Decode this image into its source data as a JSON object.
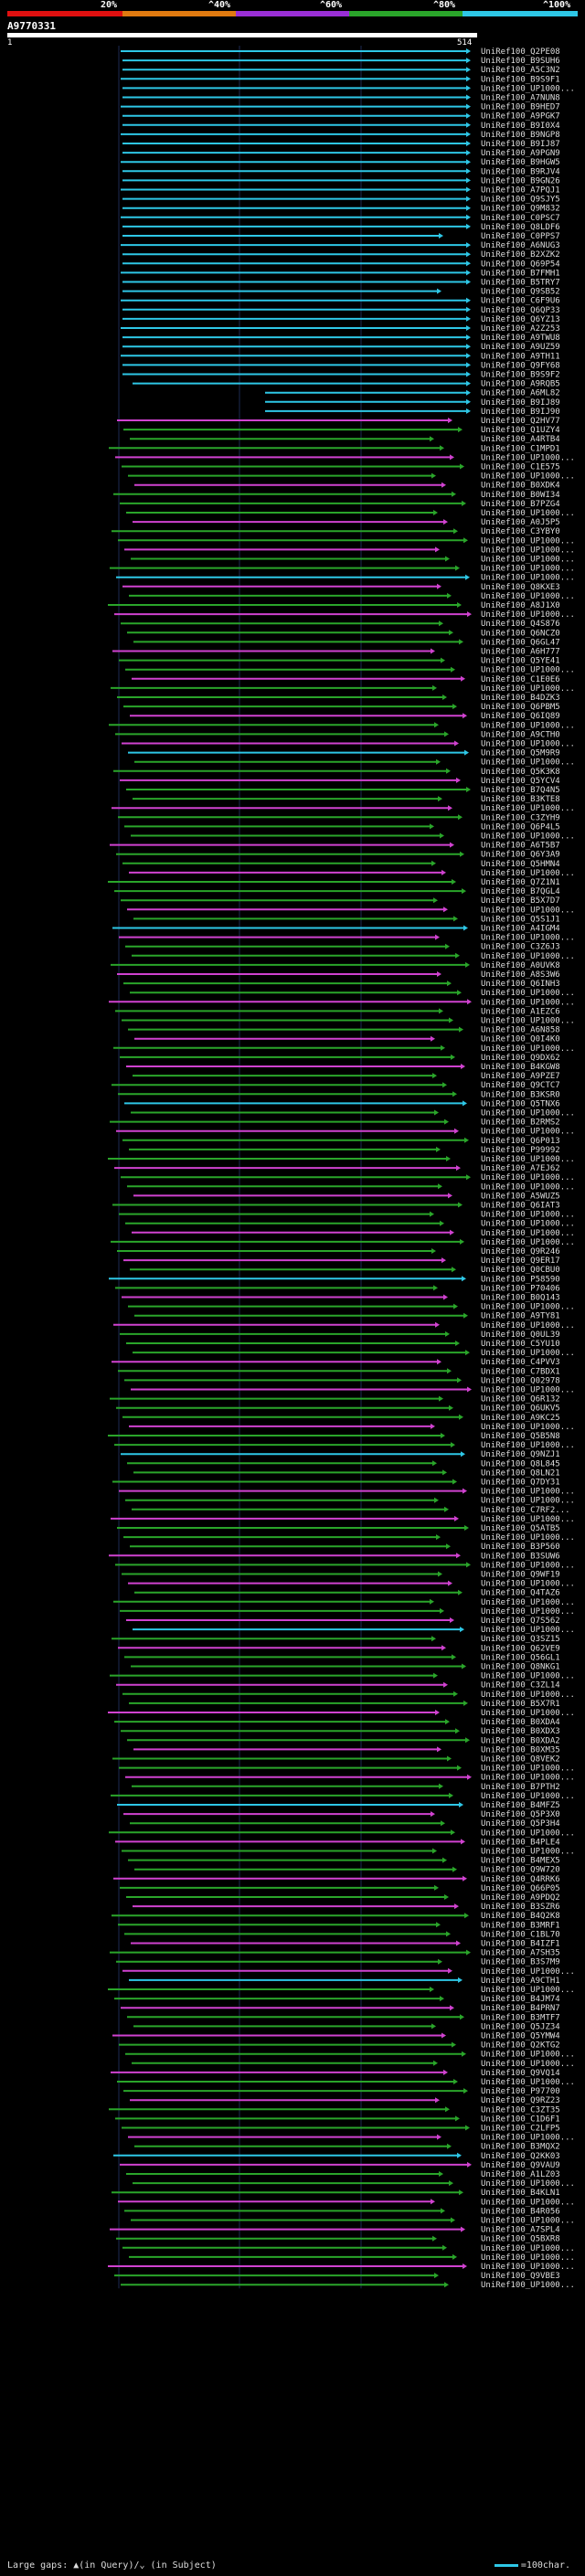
{
  "legend": {
    "ticks": [
      "20%",
      "^40%",
      "^60%",
      "^80%",
      "^100%"
    ],
    "colors": [
      "#e01010",
      "#e07a10",
      "#9a2fd6",
      "#2aa52a",
      "#2ec7e6"
    ]
  },
  "query": {
    "id": "A9770331",
    "start": "1",
    "end": "514"
  },
  "footer": {
    "text": "Large gaps: ▲(in Query)/⌄ (in Subject)",
    "scale": "=100char."
  },
  "hits": [
    "UniRef100_Q2PE08",
    "UniRef100_B9SUH6",
    "UniRef100_A5C3N2",
    "UniRef100_B9S9F1",
    "UniRef100_UP1000...",
    "UniRef100_A7NUN8",
    "UniRef100_B9HED7",
    "UniRef100_A9PGK7",
    "UniRef100_B9I0X4",
    "UniRef100_B9NGP8",
    "UniRef100_B9IJ87",
    "UniRef100_A9PGN9",
    "UniRef100_B9HGW5",
    "UniRef100_B9RJV4",
    "UniRef100_B9GN26",
    "UniRef100_A7PQJ1",
    "UniRef100_Q9SJY5",
    "UniRef100_Q9M832",
    "UniRef100_C0PSC7",
    "UniRef100_Q8LDF6",
    "UniRef100_C0PPS7",
    "UniRef100_A6NUG3",
    "UniRef100_B2XZK2",
    "UniRef100_Q69P54",
    "UniRef100_B7FMH1",
    "UniRef100_B5TRY7",
    "UniRef100_Q9SB52",
    "UniRef100_C6F9U6",
    "UniRef100_Q6QP33",
    "UniRef100_Q6YZ13",
    "UniRef100_A2Z253",
    "UniRef100_A9TWU8",
    "UniRef100_A9UZ59",
    "UniRef100_A9TH11",
    "UniRef100_Q9FY68",
    "UniRef100_B9S9F2",
    "UniRef100_A9RQB5",
    "UniRef100_A6ML82",
    "UniRef100_B9IJ89",
    "UniRef100_B9IJ90",
    "UniRef100_Q2HV77",
    "UniRef100_Q1UZY4",
    "UniRef100_A4RTB4",
    "UniRef100_C1MPD1",
    "UniRef100_UP1000...",
    "UniRef100_C1E575",
    "UniRef100_UP1000...",
    "UniRef100_B0XDK4",
    "UniRef100_B0WI34",
    "UniRef100_B7PZG4",
    "UniRef100_UP1000...",
    "UniRef100_A0J5P5",
    "UniRef100_C3YBY0",
    "UniRef100_UP1000...",
    "UniRef100_UP1000...",
    "UniRef100_UP1000...",
    "UniRef100_UP1000...",
    "UniRef100_UP1000...",
    "UniRef100_Q8KXE3",
    "UniRef100_UP1000...",
    "UniRef100_A8J1X0",
    "UniRef100_UP1000...",
    "UniRef100_Q4S876",
    "UniRef100_Q6NCZ0",
    "UniRef100_Q6GL47",
    "UniRef100_A6H777",
    "UniRef100_Q5YE41",
    "UniRef100_UP1000...",
    "UniRef100_C1E0E6",
    "UniRef100_UP1000...",
    "UniRef100_B4DZK3",
    "UniRef100_Q6PBM5",
    "UniRef100_Q6IQ89",
    "UniRef100_UP1000...",
    "UniRef100_A9CTH0",
    "UniRef100_UP1000...",
    "UniRef100_Q5M9R9",
    "UniRef100_UP1000...",
    "UniRef100_Q5K3K8",
    "UniRef100_Q5YCV4",
    "UniRef100_B7Q4N5",
    "UniRef100_B3KTE8",
    "UniRef100_UP1000...",
    "UniRef100_C3ZYH9",
    "UniRef100_Q6P4L5",
    "UniRef100_UP1000...",
    "UniRef100_A6T5B7",
    "UniRef100_Q6Y3A9",
    "UniRef100_Q5HMN4",
    "UniRef100_UP1000...",
    "UniRef100_Q7Z1N1",
    "UniRef100_B7QGL4",
    "UniRef100_B5X7D7",
    "UniRef100_UP1000...",
    "UniRef100_Q5S1J1",
    "UniRef100_A4IGM4",
    "UniRef100_UP1000...",
    "UniRef100_C3Z6J3",
    "UniRef100_UP1000...",
    "UniRef100_A0UVK8",
    "UniRef100_A8S3W6",
    "UniRef100_Q6INH3",
    "UniRef100_UP1000...",
    "UniRef100_UP1000...",
    "UniRef100_A1EZC6",
    "UniRef100_UP1000...",
    "UniRef100_A6N858",
    "UniRef100_Q0I4K0",
    "UniRef100_UP1000...",
    "UniRef100_Q9DX62",
    "UniRef100_B4KGW8",
    "UniRef100_A9PZE7",
    "UniRef100_Q9CTC7",
    "UniRef100_B3KSR0",
    "UniRef100_Q5TNX6",
    "UniRef100_UP1000...",
    "UniRef100_B2RMS2",
    "UniRef100_UP1000...",
    "UniRef100_Q6P013",
    "UniRef100_P99992",
    "UniRef100_UP1000...",
    "UniRef100_A7EJ62",
    "UniRef100_UP1000...",
    "UniRef100_UP1000...",
    "UniRef100_A5WUZ5",
    "UniRef100_Q6IAT3",
    "UniRef100_UP1000...",
    "UniRef100_UP1000...",
    "UniRef100_UP1000...",
    "UniRef100_UP1000...",
    "UniRef100_Q9R246",
    "UniRef100_Q9ER17",
    "UniRef100_Q0CBU0",
    "UniRef100_P58590",
    "UniRef100_P70406",
    "UniRef100_B0Q143",
    "UniRef100_UP1000...",
    "UniRef100_A9TY81",
    "UniRef100_UP1000...",
    "UniRef100_Q0UL39",
    "UniRef100_C5YU10",
    "UniRef100_UP1000...",
    "UniRef100_C4PVV3",
    "UniRef100_C7BDX1",
    "UniRef100_Q02978",
    "UniRef100_UP1000...",
    "UniRef100_Q6R132",
    "UniRef100_Q6UKV5",
    "UniRef100_A9KC25",
    "UniRef100_UP1000...",
    "UniRef100_Q5B5N8",
    "UniRef100_UP1000...",
    "UniRef100_Q9NZJ1",
    "UniRef100_Q8L845",
    "UniRef100_Q8LN21",
    "UniRef100_Q7DY31",
    "UniRef100_UP1000...",
    "UniRef100_UP1000...",
    "UniRef100_C7RF2...",
    "UniRef100_UP1000...",
    "UniRef100_Q5ATB5",
    "UniRef100_UP1000...",
    "UniRef100_B3P560",
    "UniRef100_B3SUW6",
    "UniRef100_UP1000...",
    "UniRef100_Q9WF19",
    "UniRef100_UP1000...",
    "UniRef100_Q4TAZ6",
    "UniRef100_UP1000...",
    "UniRef100_UP1000...",
    "UniRef100_Q7S562",
    "UniRef100_UP1000...",
    "UniRef100_Q3SZ15",
    "UniRef100_Q62VE9",
    "UniRef100_Q56GL1",
    "UniRef100_Q8NKG1",
    "UniRef100_UP1000...",
    "UniRef100_C3ZL14",
    "UniRef100_UP1000...",
    "UniRef100_B5X7R1",
    "UniRef100_UP1000...",
    "UniRef100_B0XDA4",
    "UniRef100_B0XDX3",
    "UniRef100_B0XDA2",
    "UniRef100_B0XM35",
    "UniRef100_Q8VEK2",
    "UniRef100_UP1000...",
    "UniRef100_UP1000...",
    "UniRef100_B7PTH2",
    "UniRef100_UP1000...",
    "UniRef100_B4MFZ5",
    "UniRef100_Q5P3X0",
    "UniRef100_Q5P3H4",
    "UniRef100_UP1000...",
    "UniRef100_B4PLE4",
    "UniRef100_UP1000...",
    "UniRef100_B4MEX5",
    "UniRef100_Q9W720",
    "UniRef100_Q4RRK6",
    "UniRef100_Q66P05",
    "UniRef100_A9PDQ2",
    "UniRef100_B3SZR6",
    "UniRef100_B4Q2K8",
    "UniRef100_B3MRF1",
    "UniRef100_C1BL70",
    "UniRef100_B4IZF1",
    "UniRef100_A7SH35",
    "UniRef100_B3S7M9",
    "UniRef100_UP1000...",
    "UniRef100_A9CTH1",
    "UniRef100_UP1000...",
    "UniRef100_B4JM74",
    "UniRef100_B4PRN7",
    "UniRef100_B3MTF7",
    "UniRef100_Q5JZ34",
    "UniRef100_Q5YMW4",
    "UniRef100_Q2KTG2",
    "UniRef100_UP1000...",
    "UniRef100_UP1000...",
    "UniRef100_Q9VQ14",
    "UniRef100_UP1000...",
    "UniRef100_P97700",
    "UniRef100_Q9RZ23",
    "UniRef100_C3ZT35",
    "UniRef100_C1D6F1",
    "UniRef100_C2LFP5",
    "UniRef100_UP1000...",
    "UniRef100_B3MQX2",
    "UniRef100_Q2KK03",
    "UniRef100_Q9VAU9",
    "UniRef100_A1LZ03",
    "UniRef100_UP1000...",
    "UniRef100_B4KLN1",
    "UniRef100_UP1000...",
    "UniRef100_B4R056",
    "UniRef100_UP1000...",
    "UniRef100_A7SPL4",
    "UniRef100_Q5BXR8",
    "UniRef100_UP1000...",
    "UniRef100_UP1000...",
    "UniRef100_UP1000...",
    "UniRef100_Q9VBE3",
    "UniRef100_UP1000..."
  ]
}
